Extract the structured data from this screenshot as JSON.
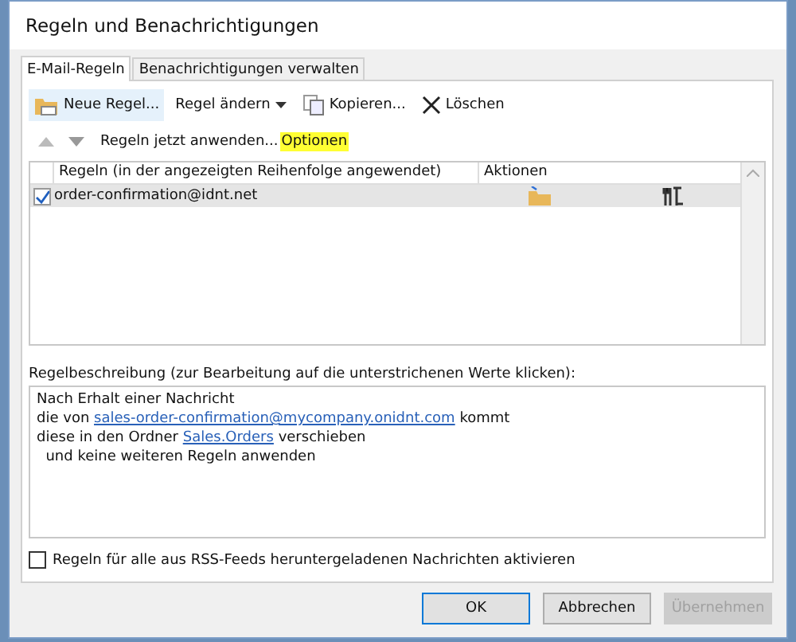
{
  "window": {
    "title": "Regeln und Benachrichtigungen"
  },
  "tabs": [
    {
      "label": "E-Mail-Regeln",
      "selected": true
    },
    {
      "label": "Benachrichtigungen verwalten",
      "selected": false
    }
  ],
  "toolbar": [
    {
      "label": "Neue Regel...",
      "kind": "new",
      "dropdown": false,
      "selected": true
    },
    {
      "label": "Regel ändern",
      "kind": "plain",
      "dropdown": true,
      "selected": false
    },
    {
      "label": "Kopieren...",
      "kind": "copy",
      "dropdown": false,
      "selected": false
    },
    {
      "label": "Löschen",
      "kind": "delete",
      "dropdown": false,
      "selected": false
    }
  ],
  "actions": [
    {
      "label": "Regeln jetzt anwenden...",
      "highlighted": false
    },
    {
      "label": "Optionen",
      "highlighted": true
    }
  ],
  "table": {
    "columns": [
      "Regeln (in der angezeigten Reihenfolge angewendet)",
      "Aktionen"
    ],
    "rows": [
      {
        "name": "order-confirmation@idnt.net",
        "checked": true,
        "selected": true
      }
    ]
  },
  "description": {
    "label": "Regelbeschreibung (zur Bearbeitung auf die unterstrichenen Werte klicken):",
    "lines": [
      [
        {
          "text": "Nach Erhalt einer Nachricht",
          "kind": "plain"
        }
      ],
      [
        {
          "text": "die von ",
          "kind": "plain"
        },
        {
          "text": "sales-order-confirmation@mycompany.onidnt.com",
          "kind": "link"
        },
        {
          "text": " kommt",
          "kind": "plain"
        }
      ],
      [
        {
          "text": "diese in den Ordner ",
          "kind": "plain"
        },
        {
          "text": "Sales.Orders",
          "kind": "link"
        },
        {
          "text": " verschieben",
          "kind": "plain"
        }
      ],
      [
        {
          "text": "  und keine weiteren Regeln anwenden",
          "kind": "plain"
        }
      ]
    ]
  },
  "rss": {
    "label": "Regeln für alle aus RSS-Feeds heruntergeladenen Nachrichten aktivieren",
    "checked": false
  },
  "buttons": [
    {
      "label": "OK",
      "disabled": false,
      "default": true
    },
    {
      "label": "Abbrechen",
      "disabled": false,
      "default": false
    },
    {
      "label": "Übernehmen",
      "disabled": true,
      "default": false
    }
  ]
}
